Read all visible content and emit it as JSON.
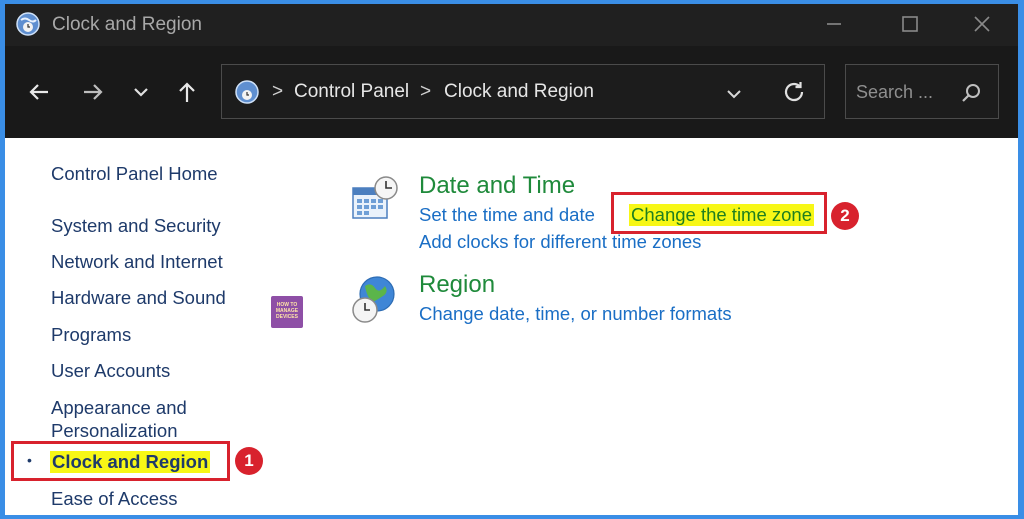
{
  "window": {
    "title": "Clock and Region",
    "controls": {
      "minimize": "—",
      "maximize": "☐",
      "close": "✕"
    }
  },
  "navigation": {
    "back_icon": "arrow-left-icon",
    "forward_icon": "arrow-right-icon",
    "recent_icon": "chevron-down-icon",
    "up_icon": "arrow-up-icon",
    "breadcrumb_separator": ">",
    "breadcrumbs": [
      "Control Panel",
      "Clock and Region"
    ],
    "search_placeholder": "Search ..."
  },
  "sidebar": {
    "home": "Control Panel Home",
    "items": [
      "System and Security",
      "Network and Internet",
      "Hardware and Sound",
      "Programs",
      "User Accounts",
      "Appearance and",
      "Personalization"
    ],
    "current": "Clock and Region",
    "bullet": "•",
    "after_current": "Ease of Access"
  },
  "categories": [
    {
      "title": "Date and Time",
      "icon": "date-time-icon",
      "tasks": [
        "Set the time and date",
        "Change the time zone",
        "Add clocks for different time zones"
      ]
    },
    {
      "title": "Region",
      "icon": "region-globe-icon",
      "tasks": [
        "Change date, time, or number formats"
      ]
    }
  ],
  "annotations": {
    "step1": "1",
    "step2": "2"
  },
  "watermark": {
    "line1": "HOW TO",
    "line2": "MANAGE",
    "line3": "DEVICES"
  },
  "colors": {
    "title_bar": "#202020",
    "nav_bar": "#191919",
    "category_title": "#1f8a3b",
    "link": "#1a6ec5",
    "highlight": "#f7f716",
    "annotation_red": "#d8222d"
  }
}
